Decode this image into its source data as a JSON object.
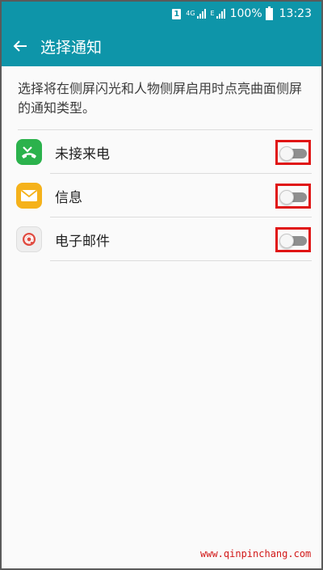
{
  "status_bar": {
    "sim_label": "1",
    "network_4g": "4G",
    "network_e": "E",
    "battery_percent": "100%",
    "time": "13:23",
    "accent_color": "#0e95a9"
  },
  "app_bar": {
    "back_icon": "arrow-left-icon",
    "title": "选择通知"
  },
  "description": "选择将在侧屏闪光和人物侧屏启用时点亮曲面侧屏的通知类型。",
  "items": [
    {
      "label": "未接来电",
      "icon": "missed-call-icon",
      "icon_color": "#2bb24c",
      "enabled": false
    },
    {
      "label": "信息",
      "icon": "message-icon",
      "icon_color": "#f5b21b",
      "enabled": false
    },
    {
      "label": "电子邮件",
      "icon": "email-icon",
      "icon_color": "#e04a3f",
      "enabled": false
    }
  ],
  "highlight_color": "#e01414",
  "watermark": "www.qinpinchang.com"
}
